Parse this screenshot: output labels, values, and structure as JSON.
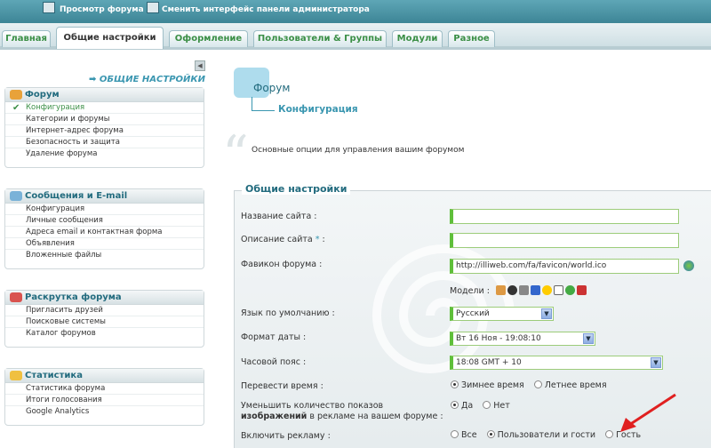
{
  "topbar": {
    "view_forum": "Просмотр форума",
    "switch_interface": "Сменить интерфейс панели администратора"
  },
  "tabs": [
    {
      "label": "Главная"
    },
    {
      "label": "Общие настройки"
    },
    {
      "label": "Оформление"
    },
    {
      "label": "Пользователи & Группы"
    },
    {
      "label": "Модули"
    },
    {
      "label": "Разное"
    }
  ],
  "sidebar": {
    "heading": "➡ ОБЩИЕ НАСТРОЙКИ",
    "sections": [
      {
        "title": "Форум",
        "items": [
          "Конфигурация",
          "Категории и форумы",
          "Интернет-адрес форума",
          "Безопасность и защита",
          "Удаление форума"
        ]
      },
      {
        "title": "Сообщения и E-mail",
        "items": [
          "Конфигурация",
          "Личные сообщения",
          "Адреса email и контактная форма",
          "Объявления",
          "Вложенные файлы"
        ]
      },
      {
        "title": "Раскрутка форума",
        "items": [
          "Пригласить друзей",
          "Поисковые системы",
          "Каталог форумов"
        ]
      },
      {
        "title": "Статистика",
        "items": [
          "Статистика форума",
          "Итоги голосования",
          "Google Analytics"
        ]
      }
    ]
  },
  "main": {
    "title": "Форум",
    "subtitle": "Конфигурация",
    "description": "Основные опции для управления вашим форумом",
    "fieldset_legend": "Общие настройки"
  },
  "form": {
    "site_name_label": "Название сайта :",
    "site_desc_label": "Описание сайта",
    "site_desc_required": "*",
    "site_desc_colon": ":",
    "favicon_label": "Фавикон форума :",
    "favicon_value": "http://illiweb.com/fa/favicon/world.ico",
    "models_label": "Модели :",
    "language_label": "Язык по умолчанию :",
    "language_value": "Русский",
    "date_format_label": "Формат даты :",
    "date_format_value": "Вт 16 Ноя - 19:08:10",
    "timezone_label": "Часовой пояс :",
    "timezone_value": "18:08 GMT + 10",
    "translate_time_label": "Перевести время :",
    "translate_opt1": "Зимнее время",
    "translate_opt2": "Летнее время",
    "reduce_images_label_line1": "Уменьшить количество показов",
    "reduce_images_label_bold": "изображений",
    "reduce_images_label_rest": "в рекламе на вашем форуме :",
    "reduce_opt_yes": "Да",
    "reduce_opt_no": "Нет",
    "ads_label": "Включить рекламу :",
    "ads_opt_all": "Все",
    "ads_opt_users": "Пользователи и гости",
    "ads_opt_guest": "Гость"
  },
  "colors": {
    "accent_blue": "#3a96b0",
    "active_green": "#3b8f46",
    "red_arrow": "#e02020"
  }
}
